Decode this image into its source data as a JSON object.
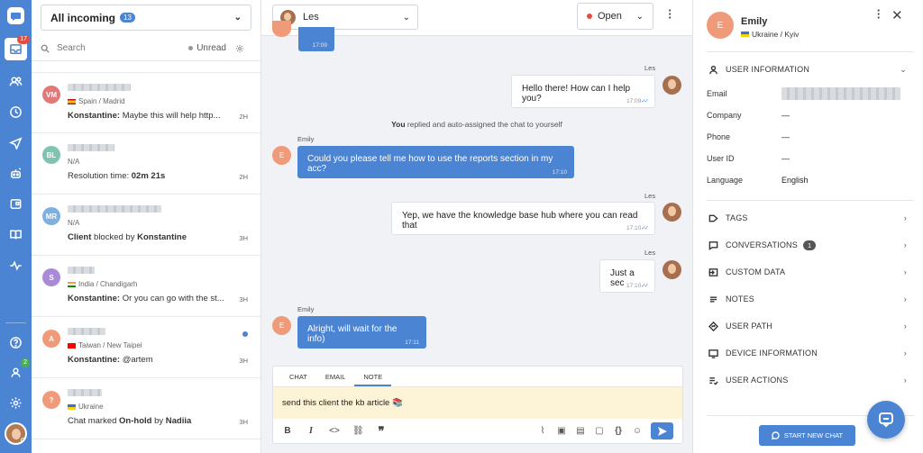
{
  "rail": {
    "inbox_badge": "17",
    "agents_badge": "2"
  },
  "inbox": {
    "filter_label": "All incoming",
    "filter_count": "13",
    "search_placeholder": "Search",
    "unread_label": "Unread",
    "conversations": [
      {
        "initials": "VM",
        "color": "#e07a7a",
        "location": "Spain / Madrid",
        "flag": "spain",
        "sender": "Konstantine:",
        "text": " Maybe this will help http...",
        "time": "2H",
        "unread": false
      },
      {
        "initials": "BL",
        "color": "#7fc4b0",
        "location": "N/A",
        "flag": "",
        "sender": "",
        "text": "Resolution time: ",
        "bold_tail": "02m 21s",
        "time": "2H",
        "unread": false
      },
      {
        "initials": "MR",
        "color": "#7fb0e0",
        "location": "N/A",
        "flag": "",
        "sender": "Client",
        "text": " blocked by ",
        "bold_tail": "Konstantine",
        "time": "3H",
        "unread": false
      },
      {
        "initials": "S",
        "color": "#a98ad6",
        "location": "India / Chandigarh",
        "flag": "india",
        "sender": "Konstantine:",
        "text": " Or you can go with the st...",
        "time": "3H",
        "unread": false
      },
      {
        "initials": "A",
        "color": "#ef9a78",
        "location": "Taiwan / New Taipei",
        "flag": "taiwan",
        "sender": "Konstantine:",
        "text": " @artem",
        "time": "3H",
        "unread": true
      },
      {
        "initials": "?",
        "color": "#ef9a78",
        "location": "Ukraine",
        "flag": "ukraine",
        "sender": "",
        "text": "Chat marked ",
        "bold_mid": "On-hold",
        "text2": " by ",
        "bold_tail": "Nadiia",
        "time": "3H",
        "unread": false
      }
    ]
  },
  "chat": {
    "agent_name": "Les",
    "status": "Open",
    "messages": {
      "m0_time": "17:09",
      "m1_sender": "Les",
      "m1_text": "Hello there! How can I help you?",
      "m1_time": "17:09",
      "system_actor": "You",
      "system_text": " replied and auto-assigned the chat to yourself",
      "m2_sender": "Emily",
      "m2_text": "Could you please tell me how to use the reports section in my acc?",
      "m2_time": "17:10",
      "m3_sender": "Les",
      "m3_text": "Yep, we have the knowledge base hub where you can read that",
      "m3_time": "17:10",
      "m4_sender": "Les",
      "m4_text": "Just a sec",
      "m4_time": "17:10",
      "m5_sender": "Emily",
      "m5_text": "Alright, will wait for the info)",
      "m5_time": "17:11",
      "emily_initial": "E"
    },
    "composer": {
      "tabs": [
        "CHAT",
        "EMAIL",
        "NOTE"
      ],
      "active_tab": "NOTE",
      "note_text": "send this client the kb article 📚"
    }
  },
  "panel": {
    "name": "Emily",
    "initial": "E",
    "location": "Ukraine / Kyiv",
    "user_info_title": "USER INFORMATION",
    "fields": [
      {
        "key": "Email",
        "value": ""
      },
      {
        "key": "Company",
        "value": "—"
      },
      {
        "key": "Phone",
        "value": "—"
      },
      {
        "key": "User ID",
        "value": "—"
      },
      {
        "key": "Language",
        "value": "English"
      }
    ],
    "sections": [
      {
        "label": "TAGS",
        "icon": "tag-icon"
      },
      {
        "label": "CONVERSATIONS",
        "icon": "chat-icon",
        "badge": "1"
      },
      {
        "label": "CUSTOM DATA",
        "icon": "import-icon"
      },
      {
        "label": "NOTES",
        "icon": "notes-icon"
      },
      {
        "label": "USER PATH",
        "icon": "route-icon"
      },
      {
        "label": "DEVICE INFORMATION",
        "icon": "device-icon"
      },
      {
        "label": "USER ACTIONS",
        "icon": "checklist-icon"
      }
    ],
    "start_chat_label": "START NEW CHAT"
  },
  "colors": {
    "accent": "#4c84d4",
    "note_bg": "#fdf3d7",
    "status_open": "#e74c3c"
  }
}
